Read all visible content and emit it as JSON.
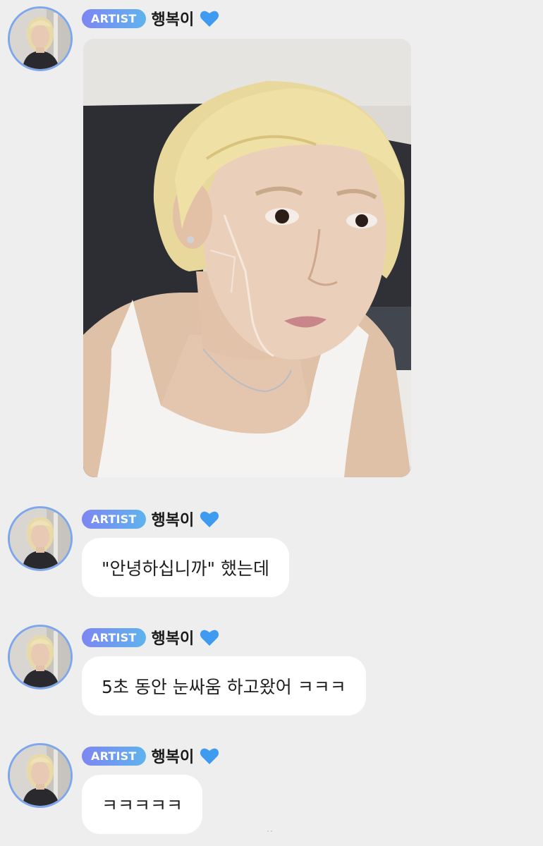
{
  "sender": {
    "badge": "ARTIST",
    "name": "행복이",
    "heart_color": "#3f9bf0"
  },
  "colors": {
    "background": "#eeeeef",
    "avatar_ring": "#7ea6ea",
    "badge_gradient_start": "#7d86f2",
    "badge_gradient_end": "#5fb3ee"
  },
  "messages": [
    {
      "type": "image",
      "icon": "selfie-photo"
    },
    {
      "type": "text",
      "text": "\"안녕하십니까\" 했는데"
    },
    {
      "type": "text",
      "text": "5초 동안 눈싸움 하고왔어 ㅋㅋㅋ"
    },
    {
      "type": "text",
      "text": "ㅋㅋㅋㅋㅋ"
    }
  ]
}
